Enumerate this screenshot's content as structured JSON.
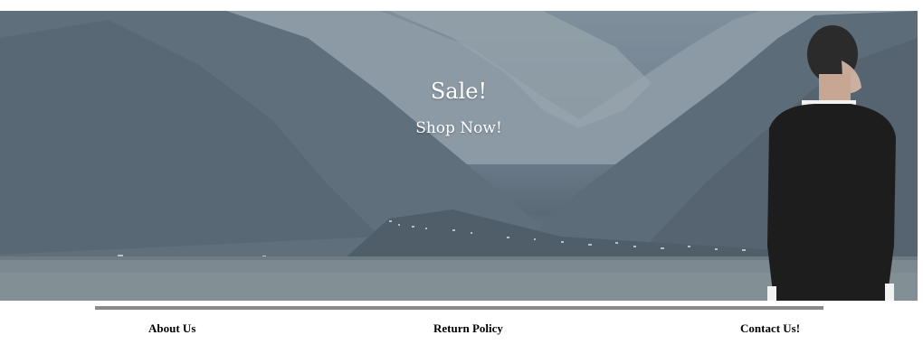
{
  "hero": {
    "title": "Sale!",
    "cta": "Shop Now!"
  },
  "footer": {
    "links": [
      {
        "label": "About Us"
      },
      {
        "label": "Return Policy"
      },
      {
        "label": "Contact Us!"
      }
    ]
  }
}
